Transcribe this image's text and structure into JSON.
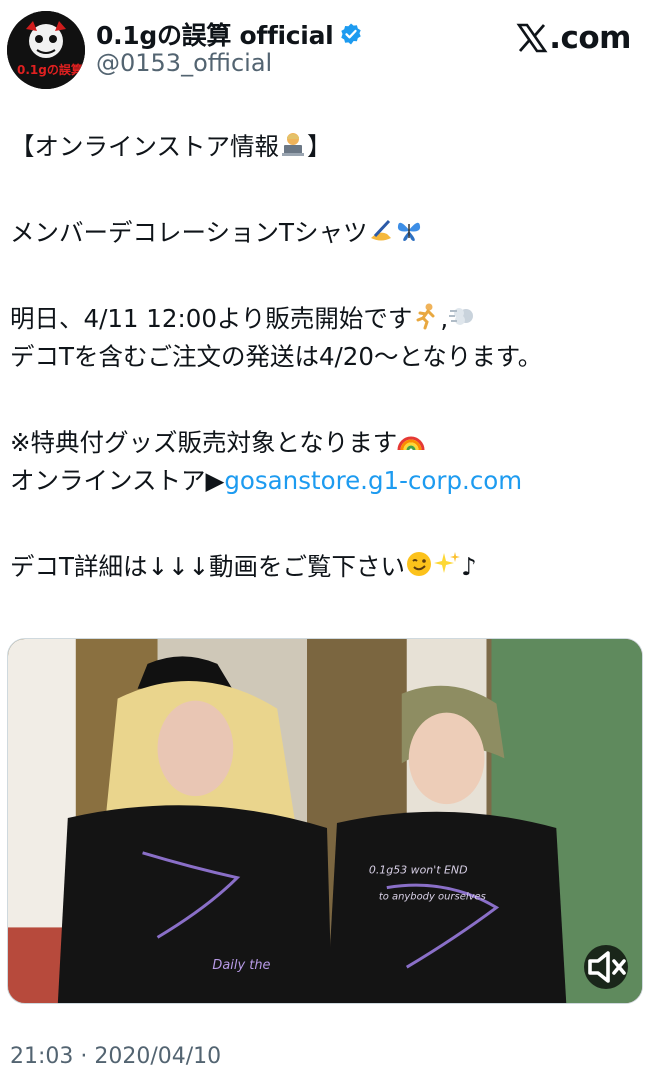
{
  "header": {
    "display_name": "0.1gの誤算 official",
    "handle": "@0153_official",
    "site_logo_text": ".com",
    "avatar_logo_text": "0.1gの誤算"
  },
  "tweet": {
    "line1": "【オンラインストア情報",
    "line2": "メンバーデコレーションTシャツ",
    "line3a": "明日、4/11 12:00より販売開始です",
    "line3b": ",",
    "line4": "デコTを含むご注文の発送は4/20〜となります。",
    "line5": "※特典付グッズ販売対象となります",
    "line6_prefix": "オンラインストア▶",
    "line6_link": "gosanstore.g1-corp.com",
    "line7a": "デコT詳細は↓↓↓動画をご覧下さい",
    "line7b": "♪",
    "bracket_close": "】"
  },
  "media": {
    "shirt_left_text": "Daily the",
    "shirt_right_text1": "0.1g53  won't END",
    "shirt_right_text2": "to anybody ourselves"
  },
  "footer": {
    "timestamp": "21:03 · 2020/04/10"
  },
  "colors": {
    "link": "#1d9bf0",
    "secondary_text": "#536471",
    "verified": "#1d9bf0"
  },
  "icons": [
    "verified-badge-icon",
    "x-logo-icon",
    "laptop-person-emoji",
    "writing-hand-emoji",
    "butterfly-emoji",
    "runner-emoji",
    "dash-emoji",
    "rainbow-emoji",
    "wink-emoji",
    "sparkles-emoji",
    "mute-icon"
  ]
}
